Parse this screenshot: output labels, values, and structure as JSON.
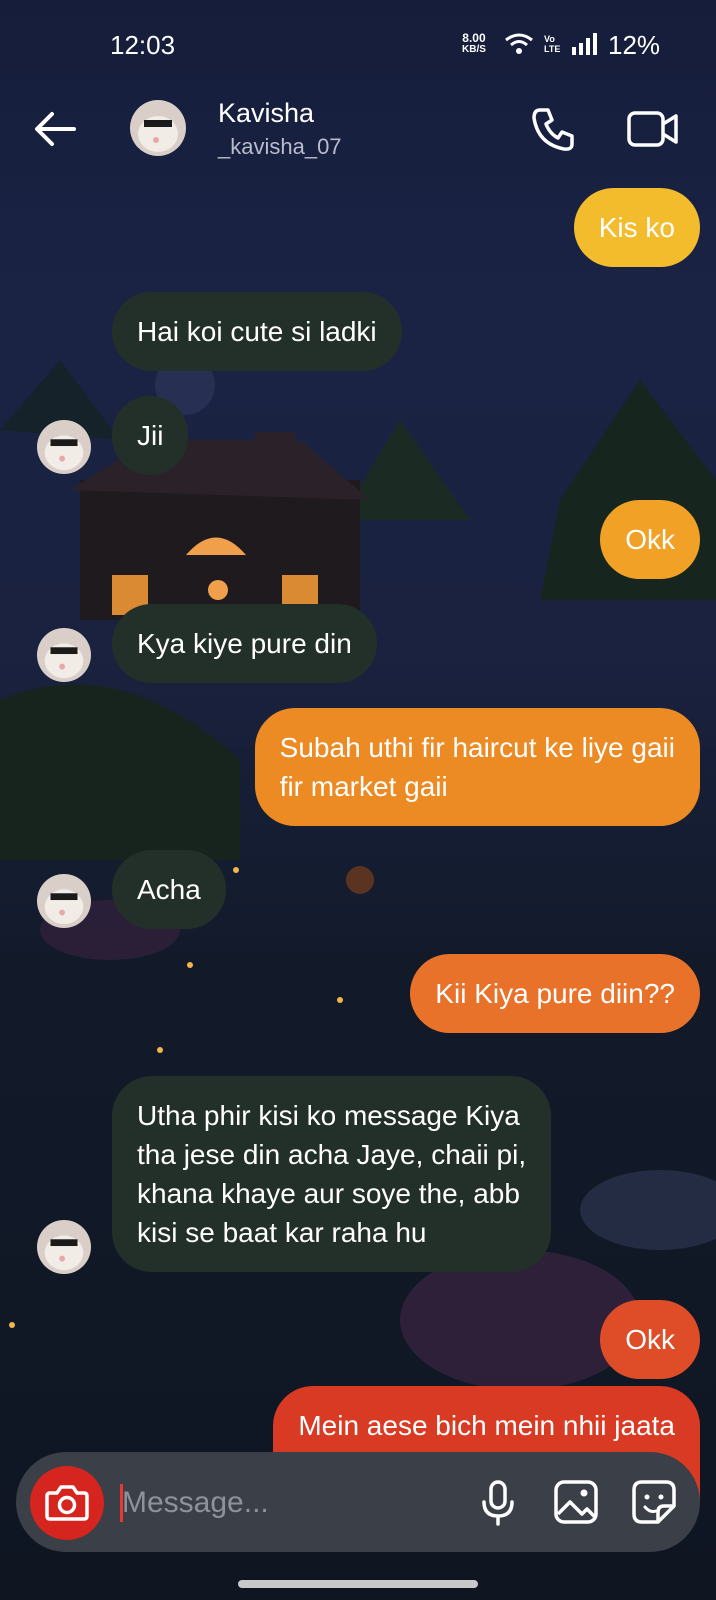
{
  "status_bar": {
    "time": "12:03",
    "net_speed_value": "8.00",
    "net_speed_unit": "KB/S",
    "volte": "Vo LTE",
    "battery": "12%"
  },
  "header": {
    "name": "Kavisha",
    "handle": "_kavisha_07"
  },
  "messages": [
    {
      "dir": "out",
      "text": "Kis ko",
      "color": "#f2bc2c"
    },
    {
      "dir": "in",
      "text": "Hai koi cute si ladki"
    },
    {
      "dir": "in",
      "text": "Jii"
    },
    {
      "dir": "out",
      "text": "Okk",
      "color": "#f0a126"
    },
    {
      "dir": "in",
      "text": "Kya kiye pure din"
    },
    {
      "dir": "out",
      "text": "Subah uthi fir haircut ke liye gaii\nfir market gaii",
      "color": "#ec8a24"
    },
    {
      "dir": "in",
      "text": "Acha"
    },
    {
      "dir": "out",
      "text": "Kii Kiya pure diin??",
      "color": "#e8722a"
    },
    {
      "dir": "in",
      "text": "Utha phir kisi ko message Kiya\ntha jese din acha Jaye, chaii pi,\nkhana khaye aur soye the, abb\nkisi se baat kar raha hu"
    },
    {
      "dir": "out",
      "text": "Okk",
      "color": "#df4c28"
    },
    {
      "dir": "out",
      "text": "Mein aese bich mein nhii jaata",
      "color": "#d83a24"
    }
  ],
  "composer": {
    "placeholder": "Message..."
  },
  "colors": {
    "incoming_bubble": "#233029",
    "camera_button": "#d6251f",
    "composer_bg": "#3b3f47"
  }
}
